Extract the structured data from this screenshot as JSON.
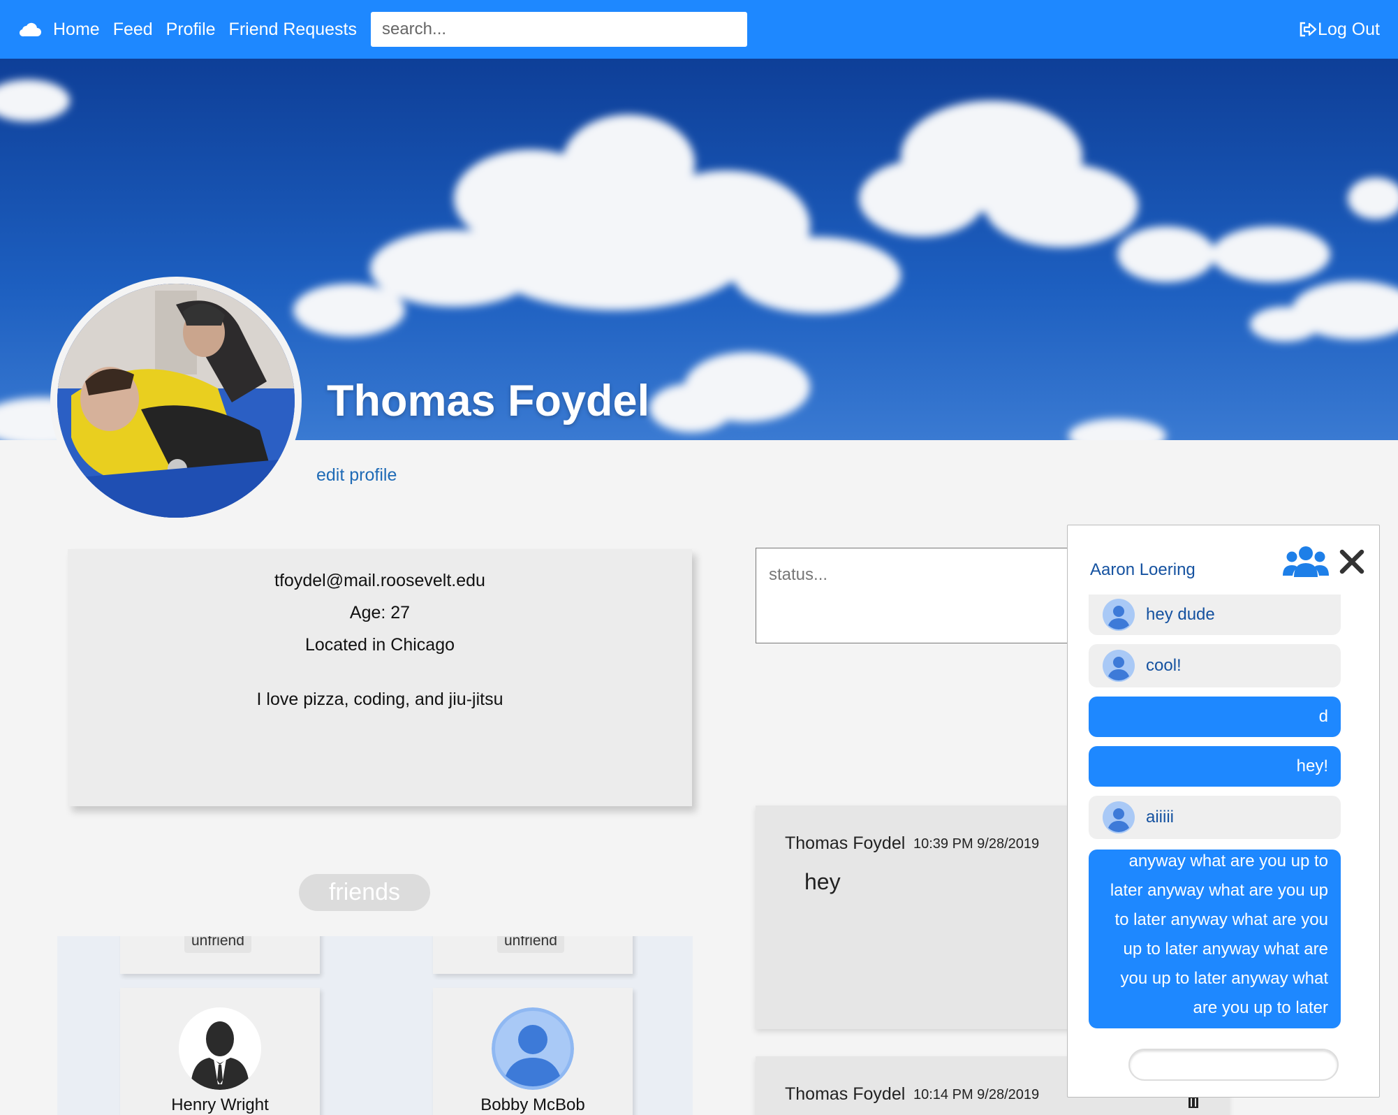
{
  "nav": {
    "links": [
      "Home",
      "Feed",
      "Profile",
      "Friend Requests"
    ],
    "search_placeholder": "search...",
    "logout_label": "Log Out"
  },
  "profile": {
    "name": "Thomas Foydel",
    "edit_label": "edit profile",
    "email": "tfoydel@mail.roosevelt.edu",
    "age": "Age: 27",
    "location": "Located in Chicago",
    "bio": "I love pizza, coding, and jiu-jitsu"
  },
  "friends": {
    "title": "friends",
    "unfriend_label": "unfriend",
    "people": [
      {
        "name": "Henry Wright",
        "avatar": "silhouette-suit"
      },
      {
        "name": "Bobby McBob",
        "avatar": "default-blue-user"
      }
    ]
  },
  "status": {
    "placeholder": "status..."
  },
  "posts": [
    {
      "author": "Thomas Foydel",
      "time": "10:39 PM 9/28/2019",
      "body": "hey"
    },
    {
      "author": "Thomas Foydel",
      "time": "10:14 PM 9/28/2019",
      "body": ""
    }
  ],
  "chat": {
    "partner": "Aaron Loering",
    "messages": [
      {
        "from": "them",
        "text": "hey dude"
      },
      {
        "from": "them",
        "text": "cool!"
      },
      {
        "from": "me",
        "text": "d"
      },
      {
        "from": "me",
        "text": "hey!"
      },
      {
        "from": "them",
        "text": "aiiiii"
      },
      {
        "from": "me",
        "lines": [
          "anyway what are you up to",
          "later anyway what are you up",
          "to later anyway what are you",
          "up to later anyway what are",
          "you up to later anyway what",
          "are you up to later"
        ]
      }
    ],
    "input_value": ""
  },
  "colors": {
    "nav": "#1e88ff",
    "chat_out": "#1e88ff",
    "chat_in": "#efefef",
    "link": "#1f6bb6",
    "chat_name": "#1552a0"
  }
}
